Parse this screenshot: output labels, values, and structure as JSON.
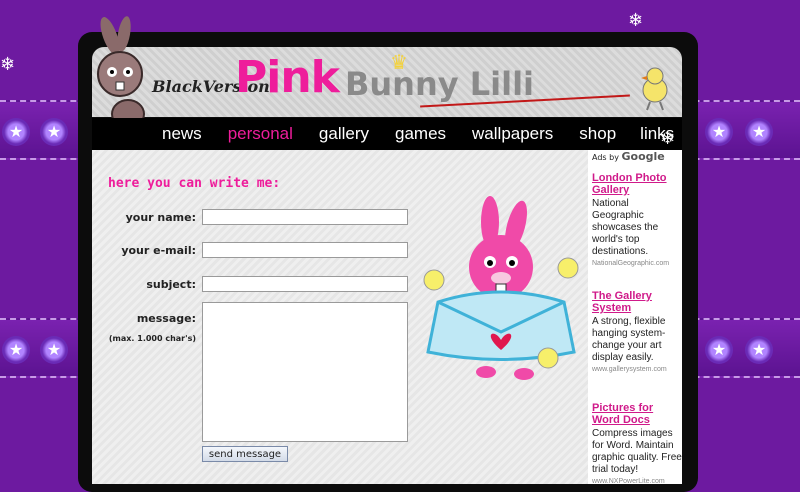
{
  "logo": {
    "prefix": "BlackVersion",
    "main": "Pink",
    "suffix": "Bunny Lilli"
  },
  "nav": {
    "items": [
      {
        "label": "news",
        "active": false
      },
      {
        "label": "personal",
        "active": true
      },
      {
        "label": "gallery",
        "active": false
      },
      {
        "label": "games",
        "active": false
      },
      {
        "label": "wallpapers",
        "active": false
      },
      {
        "label": "shop",
        "active": false
      },
      {
        "label": "links",
        "active": false
      }
    ]
  },
  "form": {
    "title": "here you can write me:",
    "name_label": "your name:",
    "email_label": "your e-mail:",
    "subject_label": "subject:",
    "message_label": "message:",
    "message_note": "(max. 1.000 char's)",
    "name_value": "",
    "email_value": "",
    "subject_value": "",
    "message_value": "",
    "send_label": "send message"
  },
  "ads": {
    "header": "Ads by",
    "provider": "Google",
    "items": [
      {
        "title": "London Photo Gallery",
        "text": "National Geographic showcases the world's top destinations.",
        "url": "NationalGeographic.com"
      },
      {
        "title": "The Gallery System",
        "text": "A strong, flexible hanging system-change your art display easily.",
        "url": "www.gallerysystem.com"
      },
      {
        "title": "Pictures for Word Docs",
        "text": "Compress images for Word. Maintain graphic quality. Free trial today!",
        "url": "www.NXPowerLite.com"
      }
    ]
  },
  "colors": {
    "accent": "#ee1d9b",
    "background": "#6d1aa0"
  },
  "icons": {
    "snowflake": "snowflake-icon",
    "star": "star-icon"
  }
}
